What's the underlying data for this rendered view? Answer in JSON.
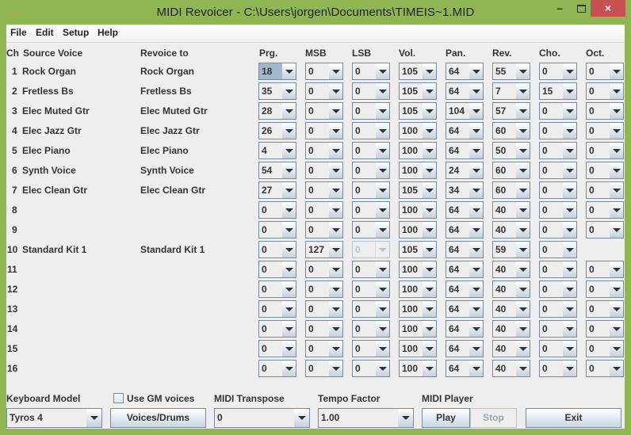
{
  "window": {
    "title": "MIDI Revoicer - C:\\Users\\jorgen\\Documents\\TIMEIS~1.MID",
    "app_icon": "music-notes-icon",
    "min_glyph": "–",
    "close_glyph": "×"
  },
  "menu": [
    "File",
    "Edit",
    "Setup",
    "Help"
  ],
  "headers": {
    "ch": "Ch",
    "source": "Source Voice",
    "revoice": "Revoice to",
    "prg": "Prg.",
    "msb": "MSB",
    "lsb": "LSB",
    "vol": "Vol.",
    "pan": "Pan.",
    "rev": "Rev.",
    "cho": "Cho.",
    "oct": "Oct."
  },
  "rows": [
    {
      "ch": "1",
      "source": "Rock Organ",
      "revoice": "Rock Organ",
      "prg": "18",
      "msb": "0",
      "lsb": "0",
      "vol": "105",
      "pan": "64",
      "rev": "55",
      "cho": "0",
      "oct": "0"
    },
    {
      "ch": "2",
      "source": "Fretless Bs",
      "revoice": "Fretless Bs",
      "prg": "35",
      "msb": "0",
      "lsb": "0",
      "vol": "105",
      "pan": "64",
      "rev": "7",
      "cho": "15",
      "oct": "0"
    },
    {
      "ch": "3",
      "source": "Elec Muted Gtr",
      "revoice": "Elec Muted Gtr",
      "prg": "28",
      "msb": "0",
      "lsb": "0",
      "vol": "105",
      "pan": "104",
      "rev": "57",
      "cho": "0",
      "oct": "0"
    },
    {
      "ch": "4",
      "source": "Elec Jazz Gtr",
      "revoice": "Elec Jazz Gtr",
      "prg": "26",
      "msb": "0",
      "lsb": "0",
      "vol": "100",
      "pan": "64",
      "rev": "60",
      "cho": "0",
      "oct": "0"
    },
    {
      "ch": "5",
      "source": "Elec Piano",
      "revoice": "Elec Piano",
      "prg": "4",
      "msb": "0",
      "lsb": "0",
      "vol": "100",
      "pan": "64",
      "rev": "50",
      "cho": "0",
      "oct": "0"
    },
    {
      "ch": "6",
      "source": "Synth Voice",
      "revoice": "Synth Voice",
      "prg": "54",
      "msb": "0",
      "lsb": "0",
      "vol": "100",
      "pan": "24",
      "rev": "60",
      "cho": "0",
      "oct": "0"
    },
    {
      "ch": "7",
      "source": "Elec Clean Gtr",
      "revoice": "Elec Clean Gtr",
      "prg": "27",
      "msb": "0",
      "lsb": "0",
      "vol": "105",
      "pan": "34",
      "rev": "60",
      "cho": "0",
      "oct": "0"
    },
    {
      "ch": "8",
      "source": "",
      "revoice": "",
      "prg": "0",
      "msb": "0",
      "lsb": "0",
      "vol": "100",
      "pan": "64",
      "rev": "40",
      "cho": "0",
      "oct": "0"
    },
    {
      "ch": "9",
      "source": "",
      "revoice": "",
      "prg": "0",
      "msb": "0",
      "lsb": "0",
      "vol": "100",
      "pan": "64",
      "rev": "40",
      "cho": "0",
      "oct": "0"
    },
    {
      "ch": "10",
      "source": "Standard Kit 1",
      "revoice": "Standard Kit 1",
      "prg": "0",
      "msb": "127",
      "lsb": "0",
      "vol": "105",
      "pan": "64",
      "rev": "59",
      "cho": "0",
      "oct": null,
      "lsb_disabled": true
    },
    {
      "ch": "11",
      "source": "",
      "revoice": "",
      "prg": "0",
      "msb": "0",
      "lsb": "0",
      "vol": "100",
      "pan": "64",
      "rev": "40",
      "cho": "0",
      "oct": "0"
    },
    {
      "ch": "12",
      "source": "",
      "revoice": "",
      "prg": "0",
      "msb": "0",
      "lsb": "0",
      "vol": "100",
      "pan": "64",
      "rev": "40",
      "cho": "0",
      "oct": "0"
    },
    {
      "ch": "13",
      "source": "",
      "revoice": "",
      "prg": "0",
      "msb": "0",
      "lsb": "0",
      "vol": "100",
      "pan": "64",
      "rev": "40",
      "cho": "0",
      "oct": "0"
    },
    {
      "ch": "14",
      "source": "",
      "revoice": "",
      "prg": "0",
      "msb": "0",
      "lsb": "0",
      "vol": "100",
      "pan": "64",
      "rev": "40",
      "cho": "0",
      "oct": "0"
    },
    {
      "ch": "15",
      "source": "",
      "revoice": "",
      "prg": "0",
      "msb": "0",
      "lsb": "0",
      "vol": "100",
      "pan": "64",
      "rev": "40",
      "cho": "0",
      "oct": "0"
    },
    {
      "ch": "16",
      "source": "",
      "revoice": "",
      "prg": "0",
      "msb": "0",
      "lsb": "0",
      "vol": "100",
      "pan": "64",
      "rev": "40",
      "cho": "0",
      "oct": "0"
    }
  ],
  "bottom": {
    "keyboard_model_label": "Keyboard Model",
    "keyboard_model_value": "Tyros 4",
    "use_gm_label": "Use GM voices",
    "use_gm_checked": false,
    "voices_drums_button": "Voices/Drums",
    "midi_transpose_label": "MIDI Transpose",
    "midi_transpose_value": "0",
    "tempo_factor_label": "Tempo Factor",
    "tempo_factor_value": "1.00",
    "midi_player_label": "MIDI Player",
    "play_button": "Play",
    "stop_button": "Stop",
    "exit_button": "Exit"
  }
}
